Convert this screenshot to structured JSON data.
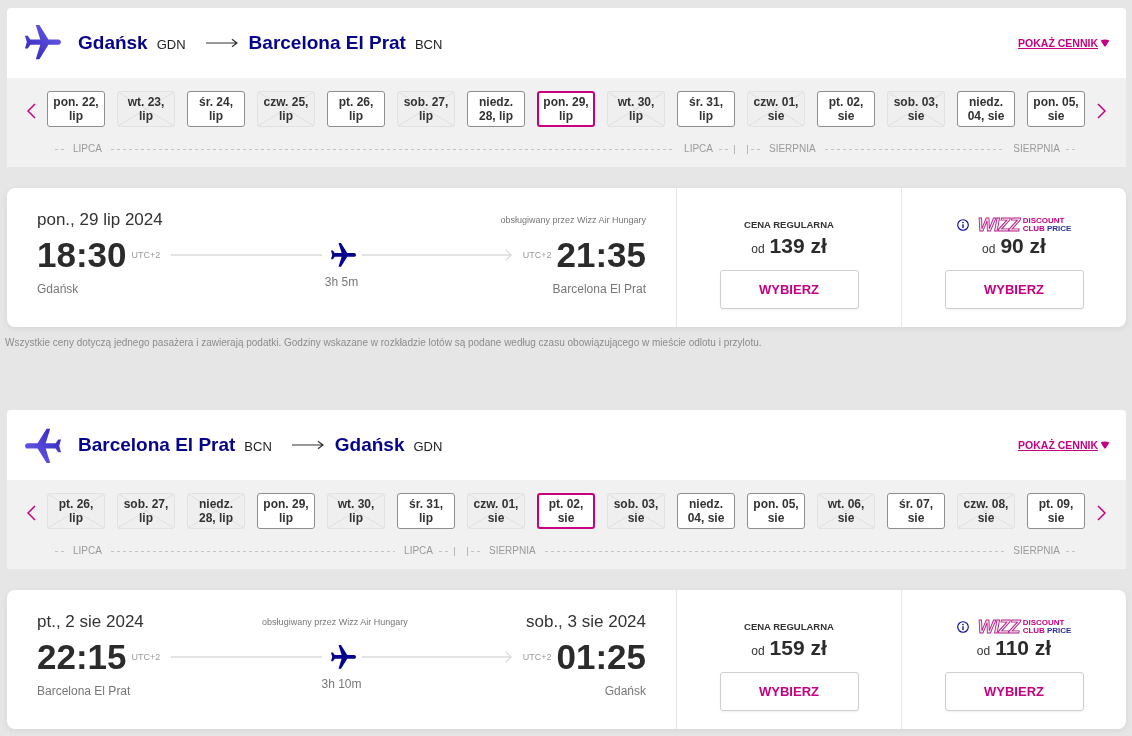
{
  "journeys": [
    {
      "kind": "outbound",
      "route": {
        "origin": {
          "city": "Gdańsk",
          "code": "GDN"
        },
        "destination": {
          "city": "Barcelona El Prat",
          "code": "BCN"
        }
      },
      "fare_link": "POKAŻ CENNIK",
      "date_strip": {
        "months": [
          {
            "start_label": "LIPCA",
            "end_label": "LIPCA",
            "dates": [
              {
                "label": "pon. 22, lip",
                "disabled": false,
                "selected": false
              },
              {
                "label": "wt. 23, lip",
                "disabled": true,
                "selected": false
              },
              {
                "label": "śr. 24, lip",
                "disabled": false,
                "selected": false
              },
              {
                "label": "czw. 25, lip",
                "disabled": true,
                "selected": false
              },
              {
                "label": "pt. 26, lip",
                "disabled": false,
                "selected": false
              },
              {
                "label": "sob. 27, lip",
                "disabled": true,
                "selected": false
              },
              {
                "label": "niedz. 28, lip",
                "disabled": false,
                "selected": false
              },
              {
                "label": "pon. 29, lip",
                "disabled": false,
                "selected": true
              },
              {
                "label": "wt. 30, lip",
                "disabled": true,
                "selected": false
              },
              {
                "label": "śr. 31, lip",
                "disabled": false,
                "selected": false
              }
            ]
          },
          {
            "start_label": "SIERPNIA",
            "end_label": "SIERPNIA",
            "dates": [
              {
                "label": "czw. 01, sie",
                "disabled": true,
                "selected": false
              },
              {
                "label": "pt. 02, sie",
                "disabled": false,
                "selected": false
              },
              {
                "label": "sob. 03, sie",
                "disabled": true,
                "selected": false
              },
              {
                "label": "niedz. 04, sie",
                "disabled": false,
                "selected": false
              },
              {
                "label": "pon. 05, sie",
                "disabled": false,
                "selected": false
              }
            ]
          }
        ]
      },
      "flight": {
        "departure_date": "pon., 29 lip 2024",
        "operator": "obsługiwany przez Wizz Air Hungary",
        "departure": {
          "time": "18:30",
          "timezone": "UTC+2",
          "city": "Gdańsk"
        },
        "duration": "3h 5m",
        "arrival": {
          "time": "21:35",
          "timezone": "UTC+2",
          "city": "Barcelona El Prat"
        },
        "fares": [
          {
            "kind": "regular",
            "title": "CENA REGULARNA",
            "prefix": "od",
            "price": "139 zł",
            "button": "WYBIERZ"
          },
          {
            "kind": "club",
            "logo": {
              "wordmark": "WIZZ",
              "top": "DISCOUNT",
              "bottom": "CLUB",
              "bottom_accent": "PRICE"
            },
            "prefix": "od",
            "price": "90 zł",
            "button": "WYBIERZ"
          }
        ]
      },
      "footnote": "Wszystkie ceny dotyczą jednego pasażera i zawierają podatki. Godziny wskazane w rozkładzie lotów są podane według czasu obowiązującego w mieście odlotu i przylotu."
    },
    {
      "kind": "return",
      "route": {
        "origin": {
          "city": "Barcelona El Prat",
          "code": "BCN"
        },
        "destination": {
          "city": "Gdańsk",
          "code": "GDN"
        }
      },
      "fare_link": "POKAŻ CENNIK",
      "date_strip": {
        "months": [
          {
            "start_label": "LIPCA",
            "end_label": "LIPCA",
            "dates": [
              {
                "label": "pt. 26, lip",
                "disabled": true,
                "selected": false
              },
              {
                "label": "sob. 27, lip",
                "disabled": true,
                "selected": false
              },
              {
                "label": "niedz. 28, lip",
                "disabled": true,
                "selected": false
              },
              {
                "label": "pon. 29, lip",
                "disabled": false,
                "selected": false
              },
              {
                "label": "wt. 30, lip",
                "disabled": true,
                "selected": false
              },
              {
                "label": "śr. 31, lip",
                "disabled": false,
                "selected": false
              }
            ]
          },
          {
            "start_label": "SIERPNIA",
            "end_label": "SIERPNIA",
            "dates": [
              {
                "label": "czw. 01, sie",
                "disabled": true,
                "selected": false
              },
              {
                "label": "pt. 02, sie",
                "disabled": false,
                "selected": true
              },
              {
                "label": "sob. 03, sie",
                "disabled": true,
                "selected": false
              },
              {
                "label": "niedz. 04, sie",
                "disabled": false,
                "selected": false
              },
              {
                "label": "pon. 05, sie",
                "disabled": false,
                "selected": false
              },
              {
                "label": "wt. 06, sie",
                "disabled": true,
                "selected": false
              },
              {
                "label": "śr. 07, sie",
                "disabled": false,
                "selected": false
              },
              {
                "label": "czw. 08, sie",
                "disabled": true,
                "selected": false
              },
              {
                "label": "pt. 09, sie",
                "disabled": false,
                "selected": false
              }
            ]
          }
        ]
      },
      "flight": {
        "departure_date": "pt., 2 sie 2024",
        "arrival_date": "sob., 3 sie 2024",
        "operator": "obsługiwany przez Wizz Air Hungary",
        "departure": {
          "time": "22:15",
          "timezone": "UTC+2",
          "city": "Barcelona El Prat"
        },
        "duration": "3h 10m",
        "arrival": {
          "time": "01:25",
          "timezone": "UTC+2",
          "city": "Gdańsk"
        },
        "fares": [
          {
            "kind": "regular",
            "title": "CENA REGULARNA",
            "prefix": "od",
            "price": "159 zł",
            "button": "WYBIERZ"
          },
          {
            "kind": "club",
            "logo": {
              "wordmark": "WIZZ",
              "top": "DISCOUNT",
              "bottom": "CLUB",
              "bottom_accent": "PRICE"
            },
            "prefix": "od",
            "price": "110 zł",
            "button": "WYBIERZ"
          }
        ]
      }
    }
  ]
}
